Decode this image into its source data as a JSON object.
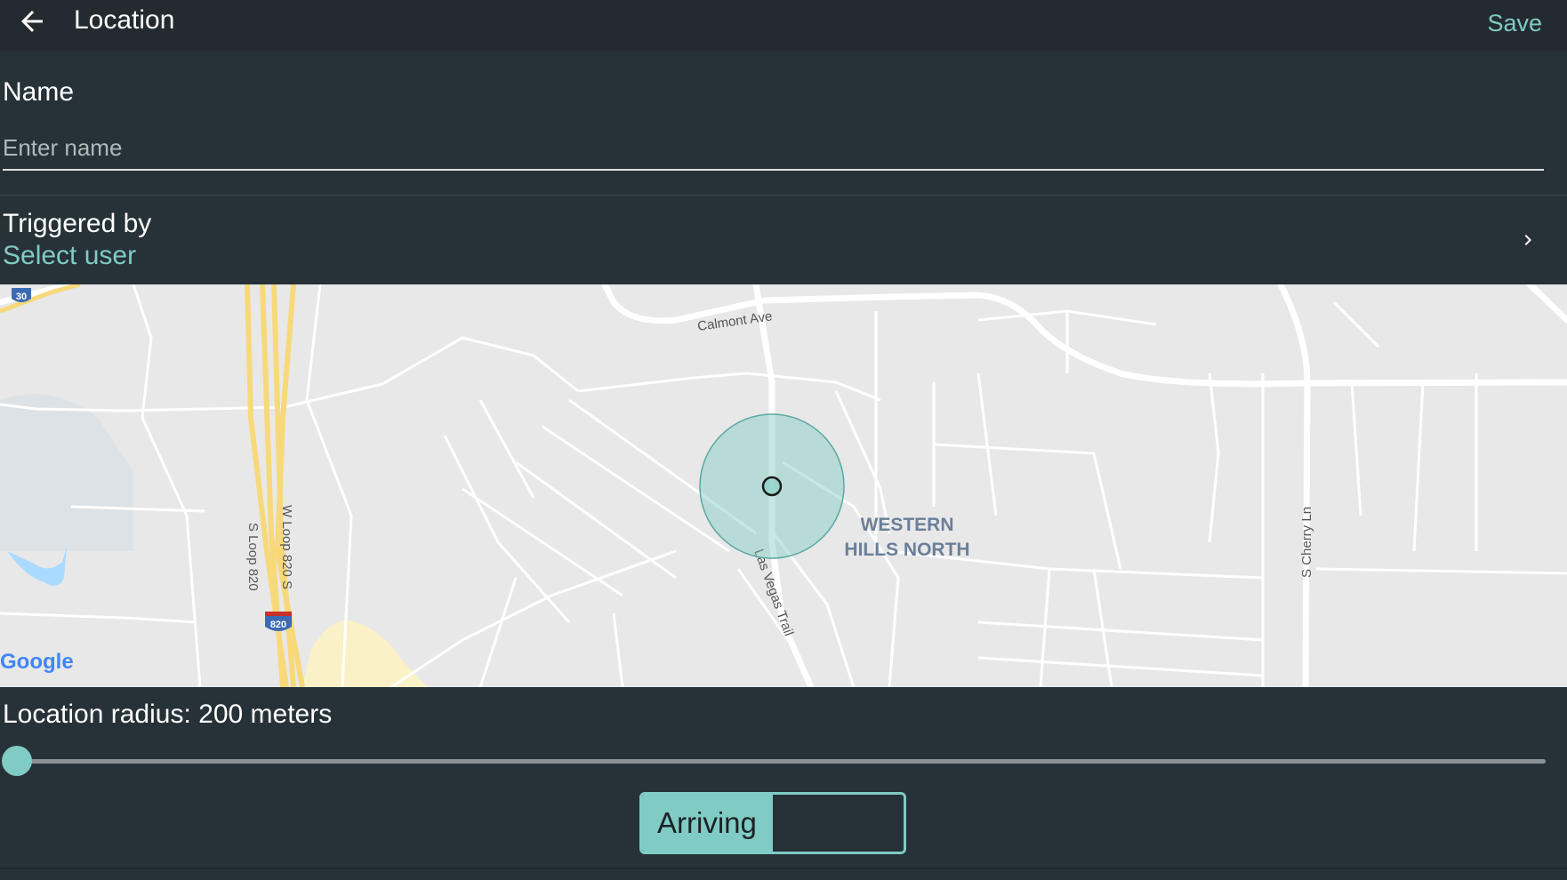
{
  "appbar": {
    "title": "Location",
    "save_label": "Save",
    "back_icon": "arrow-back-icon"
  },
  "name_field": {
    "label": "Name",
    "placeholder": "Enter name",
    "value": ""
  },
  "triggered_by": {
    "label": "Triggered by",
    "value": "Select user",
    "icon": "chevron-right-icon"
  },
  "map": {
    "labels": {
      "street_calmont": "Calmont Ave",
      "street_las_vegas": "Las Vegas Trail",
      "street_s_loop": "S Loop 820",
      "street_w_loop": "W Loop 820 S",
      "street_cherry": "S Cherry Ln",
      "neighborhood_line1": "WESTERN",
      "neighborhood_line2": "HILLS NORTH",
      "shield_30": "30",
      "shield_820": "820",
      "google_logo": "Google"
    },
    "colors": {
      "background": "#e8e8e8",
      "road": "#ffffff",
      "highway": "#f7d97a",
      "water": "#aadaff",
      "radius_fill": "#80cbc4"
    }
  },
  "radius": {
    "label": "Location radius: 200 meters",
    "slider_fraction": 0
  },
  "toggle": {
    "label": "Arriving",
    "state": "on"
  },
  "colors": {
    "accent": "#80cbc4",
    "background": "#263238",
    "appbar": "#232b30"
  }
}
